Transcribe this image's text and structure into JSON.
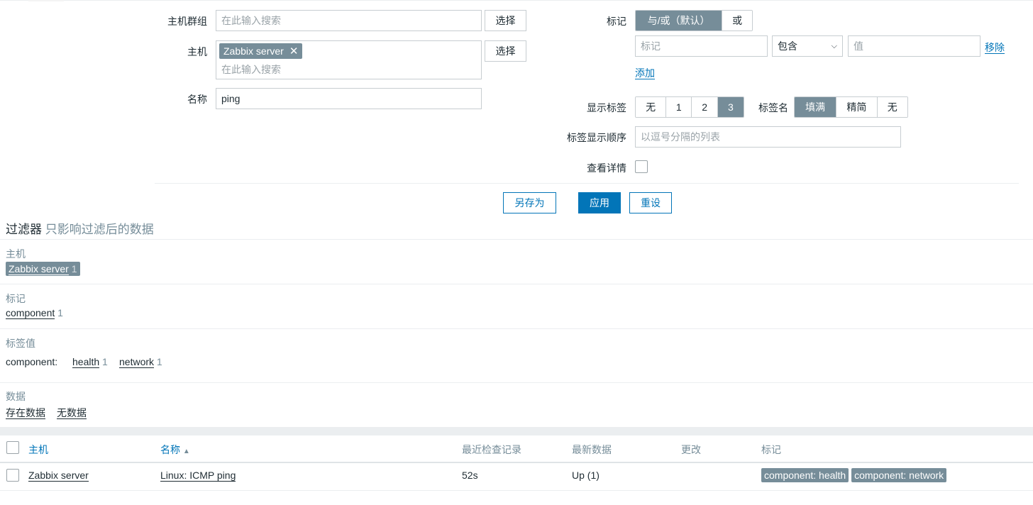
{
  "filter": {
    "host_group": {
      "label": "主机群组",
      "placeholder": "在此输入搜索",
      "select_btn": "选择"
    },
    "host": {
      "label": "主机",
      "chip": "Zabbix server",
      "placeholder": "在此输入搜索",
      "select_btn": "选择"
    },
    "name": {
      "label": "名称",
      "value": "ping"
    },
    "tags": {
      "label": "标记",
      "modes": [
        "与/或（默认）",
        "或"
      ],
      "tag_placeholder": "标记",
      "operator": "包含",
      "value_placeholder": "值",
      "remove": "移除",
      "add": "添加"
    },
    "show_tags": {
      "label": "显示标签",
      "options": [
        "无",
        "1",
        "2",
        "3"
      ]
    },
    "tag_name": {
      "label": "标签名",
      "options": [
        "填满",
        "精简",
        "无"
      ]
    },
    "tag_order": {
      "label": "标签显示顺序",
      "placeholder": "以逗号分隔的列表"
    },
    "details": {
      "label": "查看详情"
    },
    "actions": {
      "save_as": "另存为",
      "apply": "应用",
      "reset": "重设"
    }
  },
  "subfilter": {
    "title": "过滤器",
    "subtitle": "只影响过滤后的数据",
    "hosts": {
      "label": "主机",
      "items": [
        {
          "name": "Zabbix server",
          "count": "1"
        }
      ]
    },
    "tags": {
      "label": "标记",
      "items": [
        {
          "name": "component",
          "count": "1"
        }
      ]
    },
    "tag_values": {
      "label": "标签值",
      "key": "component:",
      "items": [
        {
          "name": "health",
          "count": "1"
        },
        {
          "name": "network",
          "count": "1"
        }
      ]
    },
    "data": {
      "label": "数据",
      "items": [
        "存在数据",
        "无数据"
      ]
    }
  },
  "table": {
    "headers": {
      "host": "主机",
      "name": "名称",
      "last_check": "最近检查记录",
      "last_value": "最新数据",
      "change": "更改",
      "tags": "标记"
    },
    "rows": [
      {
        "host": "Zabbix server",
        "name": "Linux: ICMP ping",
        "last_check": "52s",
        "last_value": "Up (1)",
        "change": "",
        "tags": [
          "component: health",
          "component: network"
        ]
      }
    ]
  },
  "colors": {
    "accent": "#0275b8",
    "tag_bg": "#768d99",
    "text": "#1f2c33"
  }
}
